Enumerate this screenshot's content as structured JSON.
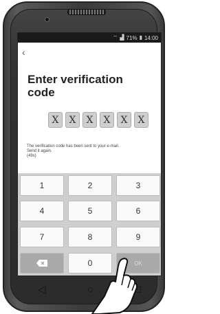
{
  "status_bar": {
    "wifi_icon": "wifi-icon",
    "signal_icon": "signal-icon",
    "battery_percent": "71%",
    "battery_icon": "battery-icon",
    "time": "14:00"
  },
  "header": {
    "back_icon": "chevron-left-icon",
    "title": "Enter verification code"
  },
  "code": {
    "digits": [
      "X",
      "X",
      "X",
      "X",
      "X",
      "X"
    ]
  },
  "message": {
    "line1": "The verification code has been sent to your e-mail.",
    "line2": "Send it again.",
    "timer": "(49s)"
  },
  "keypad": {
    "keys": [
      "1",
      "2",
      "3",
      "4",
      "5",
      "6",
      "7",
      "8",
      "9",
      "0"
    ],
    "delete_icon": "backspace-icon",
    "ok_label": "OK"
  },
  "navbar": {
    "back_icon": "triangle-back-icon",
    "home_icon": "circle-home-icon",
    "recent_icon": "square-recent-icon"
  },
  "colors": {
    "screen_bg": "#ffffff",
    "keypad_bg": "#cfcfcf",
    "code_box": "#cfcfcf",
    "special_key": "#a9a9a9"
  }
}
